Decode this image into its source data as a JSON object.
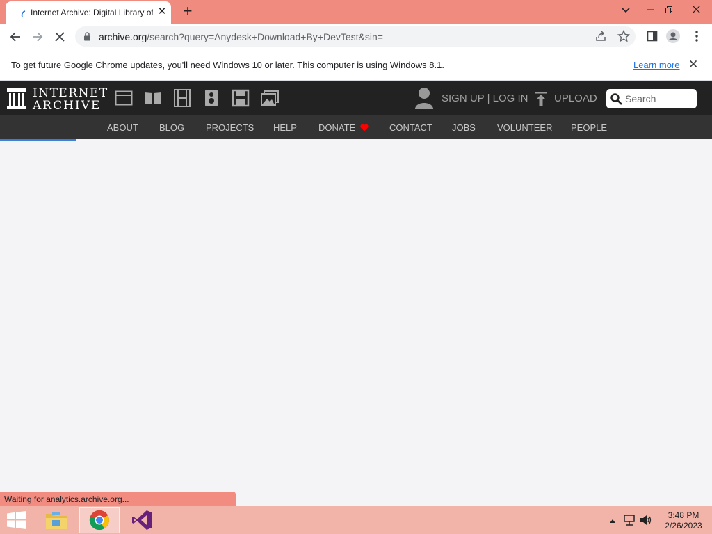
{
  "browser": {
    "tab_title": "Internet Archive: Digital Library of Free & Borrowable Books, Movies, Music & Wayback Machine",
    "url_host": "archive.org",
    "url_path": "/search?query=Anydesk+Download+By+DevTest&sin="
  },
  "infobar": {
    "message": "To get future Google Chrome updates, you'll need Windows 10 or later. This computer is using Windows 8.1.",
    "link": "Learn more"
  },
  "ia_header": {
    "logo_line1": "INTERNET",
    "logo_line2": "ARCHIVE",
    "media_icons": [
      "web-icon",
      "texts-icon",
      "video-icon",
      "audio-icon",
      "software-icon",
      "images-icon"
    ],
    "signup_login": "SIGN UP | LOG IN",
    "upload": "UPLOAD",
    "search_placeholder": "Search"
  },
  "ia_nav": [
    "ABOUT",
    "BLOG",
    "PROJECTS",
    "HELP",
    "DONATE",
    "CONTACT",
    "JOBS",
    "VOLUNTEER",
    "PEOPLE"
  ],
  "status_text": "Waiting for analytics.archive.org...",
  "taskbar": {
    "time": "3:48 PM",
    "date": "2/26/2023"
  },
  "colors": {
    "titlebar": "#f08b80",
    "ia_dark": "#222222",
    "ia_nav": "#333333",
    "donate_heart": "#ff0000",
    "taskbar": "#f2b4a9"
  }
}
